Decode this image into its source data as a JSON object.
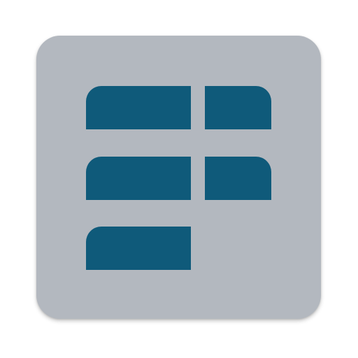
{
  "icon": {
    "name": "grid-layout-app-icon",
    "background_color": "#b3b8bf",
    "block_color": "#0f5a7a"
  }
}
